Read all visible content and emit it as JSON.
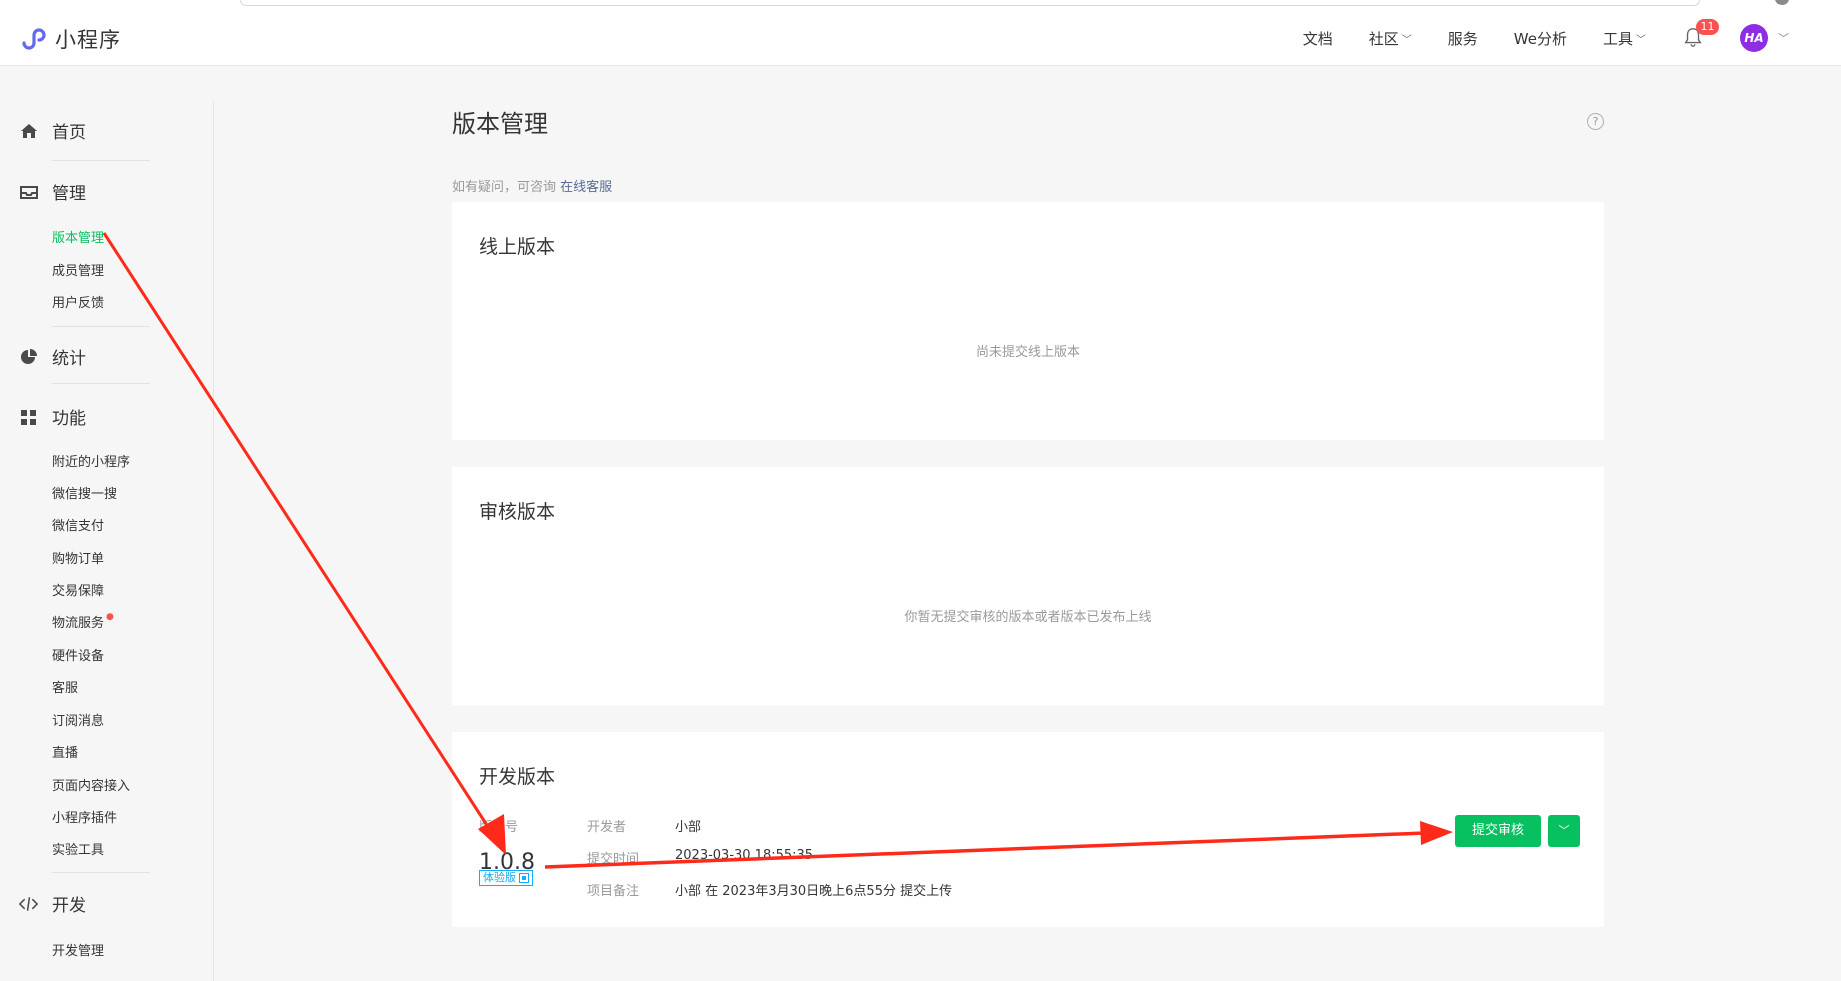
{
  "brand": {
    "name": "小程序",
    "logo_icon": "miniprogram-logo-icon",
    "logo_color": "#6467f0"
  },
  "topnav": {
    "items": [
      {
        "label": "文档",
        "has_dropdown": false
      },
      {
        "label": "社区",
        "has_dropdown": true
      },
      {
        "label": "服务",
        "has_dropdown": false
      },
      {
        "label": "We分析",
        "has_dropdown": false
      },
      {
        "label": "工具",
        "has_dropdown": true
      }
    ],
    "notifications": {
      "icon": "bell-icon",
      "count": "11"
    },
    "avatar": {
      "text": "HA",
      "color": "#8e2de2"
    }
  },
  "sidebar": {
    "sections": [
      {
        "icon": "home-icon",
        "label": "首页"
      },
      {
        "icon": "inbox-icon",
        "label": "管理",
        "items": [
          "版本管理",
          "成员管理",
          "用户反馈"
        ],
        "active": "版本管理"
      },
      {
        "icon": "pie-chart-icon",
        "label": "统计"
      },
      {
        "icon": "grid-icon",
        "label": "功能",
        "items": [
          "附近的小程序",
          "微信搜一搜",
          "微信支付",
          "购物订单",
          "交易保障",
          "物流服务",
          "硬件设备",
          "客服",
          "订阅消息",
          "直播",
          "页面内容接入",
          "小程序插件",
          "实验工具"
        ],
        "dot_item": "物流服务"
      },
      {
        "icon": "code-icon",
        "label": "开发",
        "items": [
          "开发管理"
        ]
      }
    ]
  },
  "main": {
    "title": "版本管理",
    "help_icon": "question-circle-icon",
    "hint_text": "如有疑问，可咨询",
    "hint_link": "在线客服",
    "cards": {
      "online": {
        "title": "线上版本",
        "empty": "尚未提交线上版本"
      },
      "review": {
        "title": "审核版本",
        "empty": "你暂无提交审核的版本或者版本已发布上线"
      },
      "dev": {
        "title": "开发版本",
        "version_label": "版本号",
        "version": "1.0.8",
        "tag": "体验版",
        "developer_label": "开发者",
        "developer": "小部",
        "time_label": "提交时间",
        "time": "2023-03-30 18:55:35",
        "note_label": "项目备注",
        "note": "小部 在 2023年3月30日晚上6点55分 提交上传",
        "submit_button": "提交审核",
        "more_icon": "chevron-down-icon"
      }
    }
  },
  "annotation": {
    "arrow_color": "#ff2a1a"
  },
  "colors": {
    "accent_green": "#07c160",
    "link_blue": "#576b95",
    "tag_blue": "#10aeff"
  }
}
